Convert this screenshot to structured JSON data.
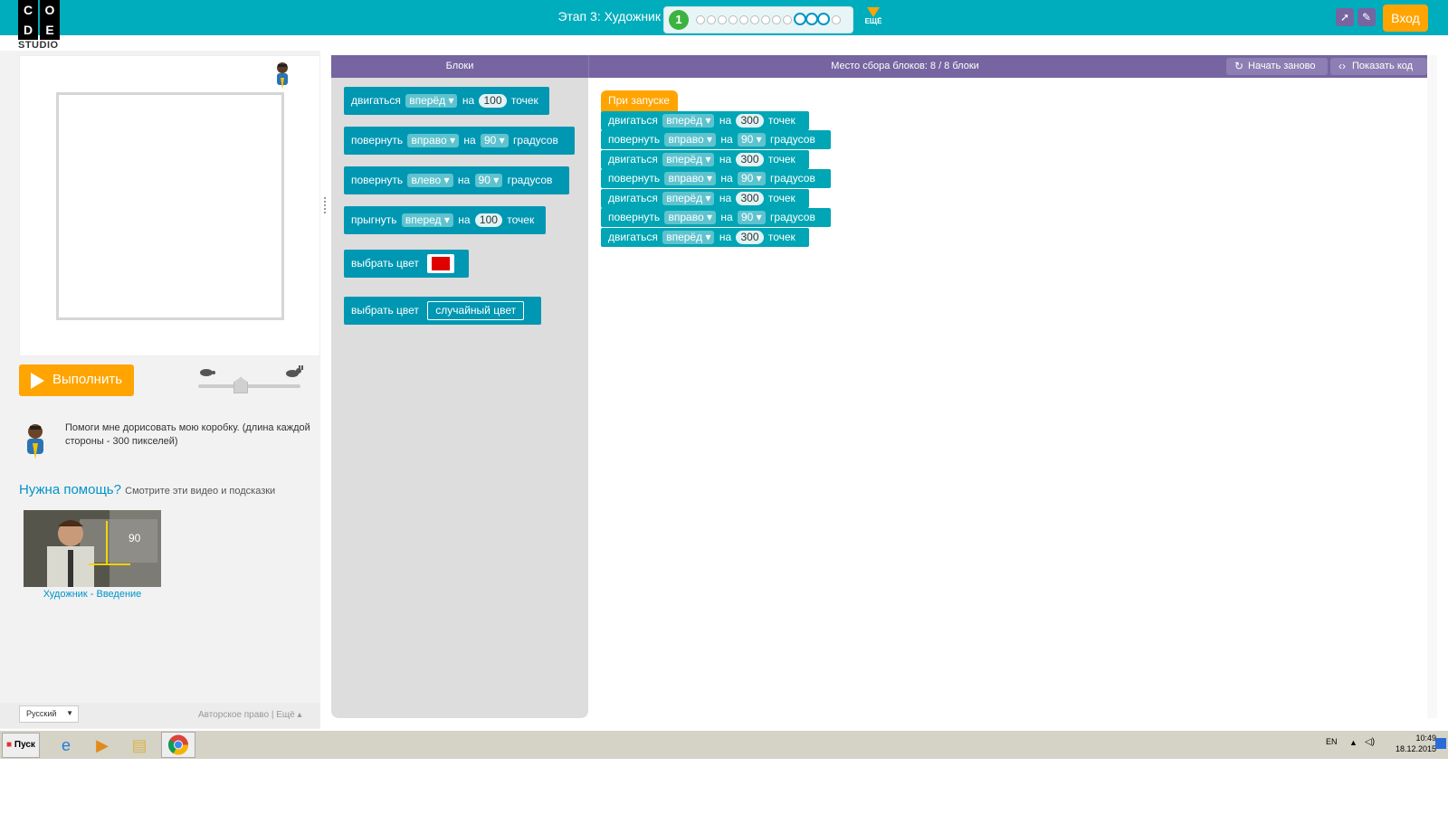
{
  "header": {
    "logo_letters": [
      "C",
      "O",
      "D",
      "E"
    ],
    "logo_sub": "STUDIO",
    "stage_title": "Этап 3: Художник",
    "current_level": "1",
    "more_label": "ЕЩЁ",
    "login_label": "Вход",
    "icons": [
      "rocket-icon",
      "pencil-icon"
    ]
  },
  "run_button": "Выполнить",
  "speed_slider": {
    "slow_icon": "turtle-icon",
    "fast_icon": "rabbit-icon",
    "value": 0.4
  },
  "instructions": "Помоги мне дорисовать мою коробку. (длина каждой стороны - 300 пикселей)",
  "help": {
    "title": "Нужна помощь?",
    "subtitle": "Смотрите эти видео и подсказки",
    "video_label": "Художник - Введение",
    "video_overlay": "90"
  },
  "footer": {
    "language": "Русский",
    "copyright": "Авторское право",
    "more": "Ещё"
  },
  "toolbox": {
    "header": "Блоки",
    "blocks": [
      {
        "pre": "двигаться",
        "dd": "вперёд",
        "mid": "на",
        "num": "100",
        "post": "точек"
      },
      {
        "pre": "повернуть",
        "dd": "вправо",
        "mid": "на",
        "num": "90",
        "post": "градусов"
      },
      {
        "pre": "повернуть",
        "dd": "влево",
        "mid": "на",
        "num": "90",
        "post": "градусов"
      },
      {
        "pre": "прыгнуть",
        "dd": "вперед",
        "mid": "на",
        "num": "100",
        "post": "точек"
      },
      {
        "pre": "выбрать цвет",
        "color": "#e00000"
      },
      {
        "pre": "выбрать цвет",
        "field": "случайный цвет"
      }
    ]
  },
  "workspace": {
    "header": "Место сбора блоков: 8 / 8 блоки",
    "restart_label": "Начать заново",
    "show_code_label": "Показать код",
    "hat_label": "При запуске",
    "blocks": [
      {
        "pre": "двигаться",
        "dd": "вперёд",
        "mid": "на",
        "num": "300",
        "post": "точек"
      },
      {
        "pre": "повернуть",
        "dd": "вправо",
        "mid": "на",
        "num": "90",
        "post": "градусов"
      },
      {
        "pre": "двигаться",
        "dd": "вперёд",
        "mid": "на",
        "num": "300",
        "post": "точек"
      },
      {
        "pre": "повернуть",
        "dd": "вправо",
        "mid": "на",
        "num": "90",
        "post": "градусов"
      },
      {
        "pre": "двигаться",
        "dd": "вперёд",
        "mid": "на",
        "num": "300",
        "post": "точек"
      },
      {
        "pre": "повернуть",
        "dd": "вправо",
        "mid": "на",
        "num": "90",
        "post": "градусов"
      },
      {
        "pre": "двигаться",
        "dd": "вперёд",
        "mid": "на",
        "num": "300",
        "post": "точек"
      }
    ]
  },
  "taskbar": {
    "start_label": "Пуск",
    "lang": "EN",
    "time": "10:49",
    "date": "18.12.2015"
  },
  "colors": {
    "top_bar": "#00adbc",
    "accent_orange": "#ffa400",
    "purple": "#7665a0",
    "block": "#00a6b5"
  }
}
